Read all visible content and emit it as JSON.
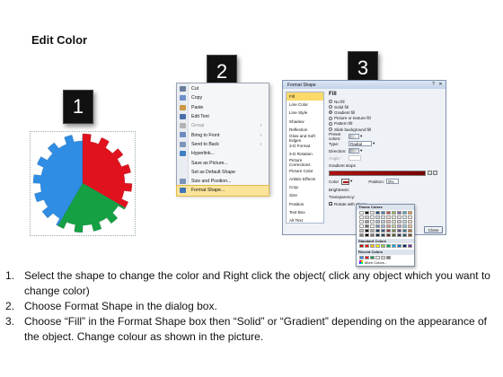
{
  "title": "Edit Color",
  "steps": [
    "1",
    "2",
    "3"
  ],
  "gear": {
    "colors": [
      "#2f8de4",
      "#e0121e",
      "#14a043"
    ]
  },
  "context_menu": {
    "items": [
      {
        "label": "Cut",
        "icon": "scissors-icon",
        "color": "#6a7d9b"
      },
      {
        "label": "Copy",
        "icon": "copy-icon",
        "color": "#6d8fc7"
      },
      {
        "label": "Paste",
        "icon": "paste-icon",
        "color": "#c89a45"
      },
      {
        "label": "Edit Text",
        "icon": "text-icon",
        "color": "#4b6ea8"
      },
      {
        "label": "Group",
        "icon": "group-icon",
        "color": "#b3b3b3",
        "disabled": true,
        "arrow": "›"
      },
      {
        "label": "Bring to Front",
        "icon": "bring-front-icon",
        "color": "#6b8cc0",
        "arrow": "›"
      },
      {
        "label": "Send to Back",
        "icon": "send-back-icon",
        "color": "#7d95bd",
        "arrow": "›"
      },
      {
        "label": "Hyperlink...",
        "icon": "globe-icon",
        "color": "#3d7fbf"
      },
      {
        "label": "Save as Picture...",
        "icon": "",
        "color": ""
      },
      {
        "label": "Set as Default Shape",
        "icon": "",
        "color": ""
      },
      {
        "label": "Size and Position...",
        "icon": "size-icon",
        "color": "#7b93b9"
      },
      {
        "label": "Format Shape...",
        "icon": "format-shape-icon",
        "color": "#3f74b8",
        "highlighted": true
      }
    ]
  },
  "dialog": {
    "title": "Format Shape",
    "categories": [
      "Fill",
      "Line Color",
      "Line Style",
      "Shadow",
      "Reflection",
      "Glow and Soft Edges",
      "3-D Format",
      "3-D Rotation",
      "Picture Corrections",
      "Picture Color",
      "Artistic Effects",
      "Crop",
      "Size",
      "Position",
      "Text Box",
      "Alt Text"
    ],
    "selected_category": "Fill",
    "heading": "Fill",
    "fill_options": [
      "No fill",
      "Solid fill",
      "Gradient fill",
      "Picture or texture fill",
      "Pattern fill",
      "Slide background fill"
    ],
    "selected_fill": "Gradient fill",
    "labels": {
      "preset": "Preset colors:",
      "type": "Type:",
      "type_value": "Radial",
      "direction": "Direction:",
      "angle": "Angle:",
      "gradient_stops": "Gradient stops",
      "color": "Color",
      "position": "Position:",
      "position_value": "0%",
      "brightness": "Brightness:",
      "transparency": "Transparency:",
      "rotate": "Rotate with shape"
    },
    "close_button": "Close",
    "gradient_color": "#b01010"
  },
  "palette": {
    "theme_label": "Theme Colors",
    "standard_label": "Standard Colors",
    "recent_label": "Recent Colors",
    "more_label": "More Colors...",
    "theme_top": [
      "#ffffff",
      "#000000",
      "#eeece1",
      "#1f497d",
      "#4f81bd",
      "#c0504d",
      "#9bbb59",
      "#8064a2",
      "#4bacc6",
      "#f79646"
    ],
    "standard": [
      "#c00000",
      "#ff0000",
      "#ffc000",
      "#ffff00",
      "#92d050",
      "#00b050",
      "#00b0f0",
      "#0070c0",
      "#002060",
      "#7030a0"
    ],
    "recent": [
      "#2f8de4",
      "#e0121e",
      "#14a043",
      "#ffffff",
      "#d9d9d9",
      "#7f7f7f"
    ]
  },
  "instructions": [
    {
      "num": "1.",
      "text": "Select the shape to change the color and Right click the object( click any object which you want to change color)"
    },
    {
      "num": "2.",
      "text": "Choose Format Shape in the dialog box."
    },
    {
      "num": "3.",
      "text": "Choose “Fill” in the Format Shape box then “Solid” or “Gradient” depending on the appearance of the object. Change colour as shown in the picture."
    }
  ]
}
